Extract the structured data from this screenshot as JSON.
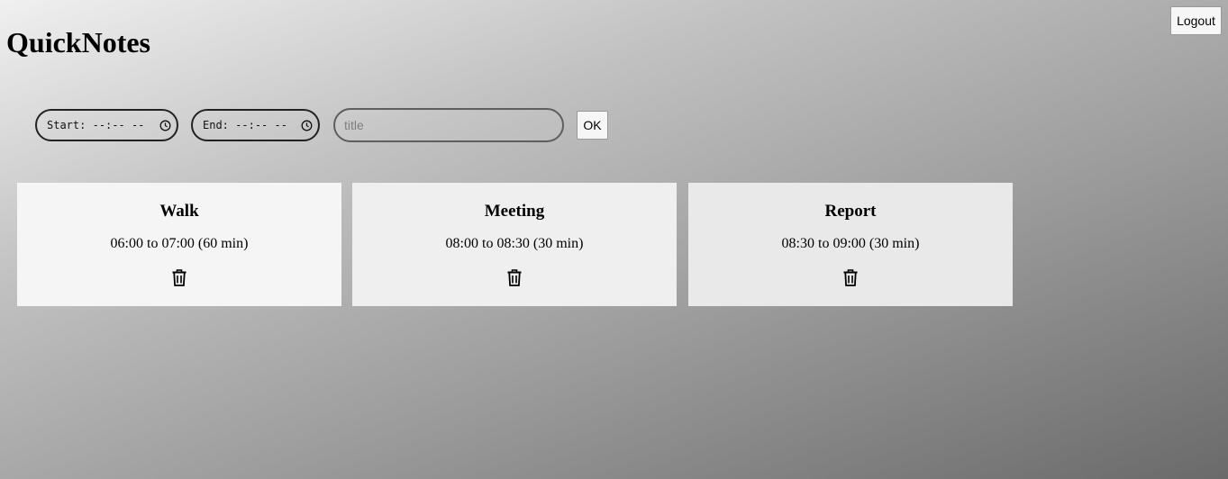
{
  "app": {
    "title": "QuickNotes",
    "logout_label": "Logout"
  },
  "form": {
    "start_label": "Start:",
    "start_value": "--:-- --",
    "end_label": "End:",
    "end_value": "--:-- --",
    "title_placeholder": "title",
    "title_value": "",
    "ok_label": "OK"
  },
  "notes": [
    {
      "title": "Walk",
      "time": "06:00 to 07:00 (60 min)",
      "icon": "trash-icon"
    },
    {
      "title": "Meeting",
      "time": "08:00 to 08:30 (30 min)",
      "icon": "trash-icon"
    },
    {
      "title": "Report",
      "time": "08:30 to 09:00 (30 min)",
      "icon": "trash-icon"
    }
  ]
}
